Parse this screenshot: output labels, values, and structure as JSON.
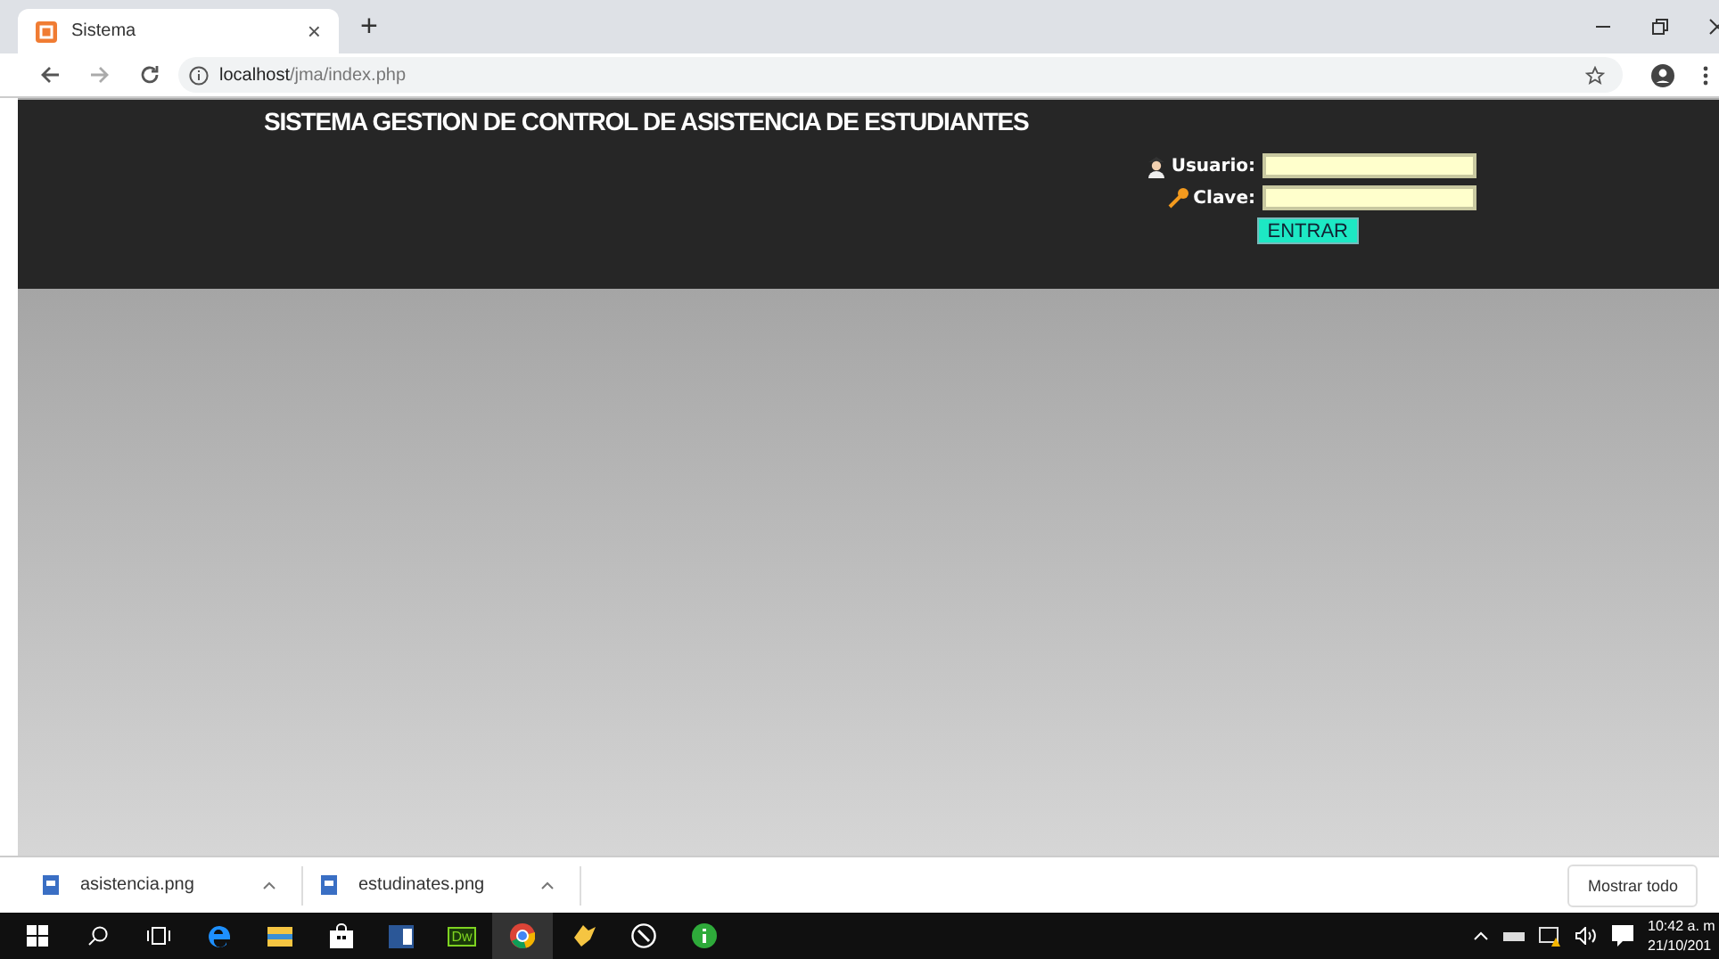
{
  "browser": {
    "tab": {
      "title": "Sistema",
      "close": "×"
    },
    "new_tab": "+",
    "url_host": "localhost",
    "url_path": "/jma/index.php"
  },
  "header": {
    "title": "SISTEMA GESTION DE CONTROL DE ASISTENCIA DE ESTUDIANTES",
    "fields": [
      {
        "label": "Usuario:",
        "kind": "user"
      },
      {
        "label": "Clave:",
        "kind": "key"
      }
    ],
    "submit": "ENTRAR"
  },
  "downloads": {
    "items": [
      {
        "name": "asistencia.png"
      },
      {
        "name": "estudinates.png"
      }
    ],
    "show_all": "Mostrar todo"
  },
  "taskbar": {
    "apps": [
      {
        "kind": "start",
        "selected": false
      },
      {
        "kind": "search",
        "selected": false
      },
      {
        "kind": "taskview",
        "selected": false
      },
      {
        "kind": "edge",
        "selected": false
      },
      {
        "kind": "folder",
        "selected": false
      },
      {
        "kind": "store",
        "selected": false
      },
      {
        "kind": "word",
        "selected": false
      },
      {
        "kind": "dw",
        "label": "Dw",
        "selected": false
      },
      {
        "kind": "chrome",
        "selected": true
      },
      {
        "kind": "yellow",
        "selected": false
      },
      {
        "kind": "pen",
        "selected": false
      },
      {
        "kind": "info",
        "selected": false
      }
    ],
    "time": "10:42 a. m",
    "date": "21/10/201"
  }
}
